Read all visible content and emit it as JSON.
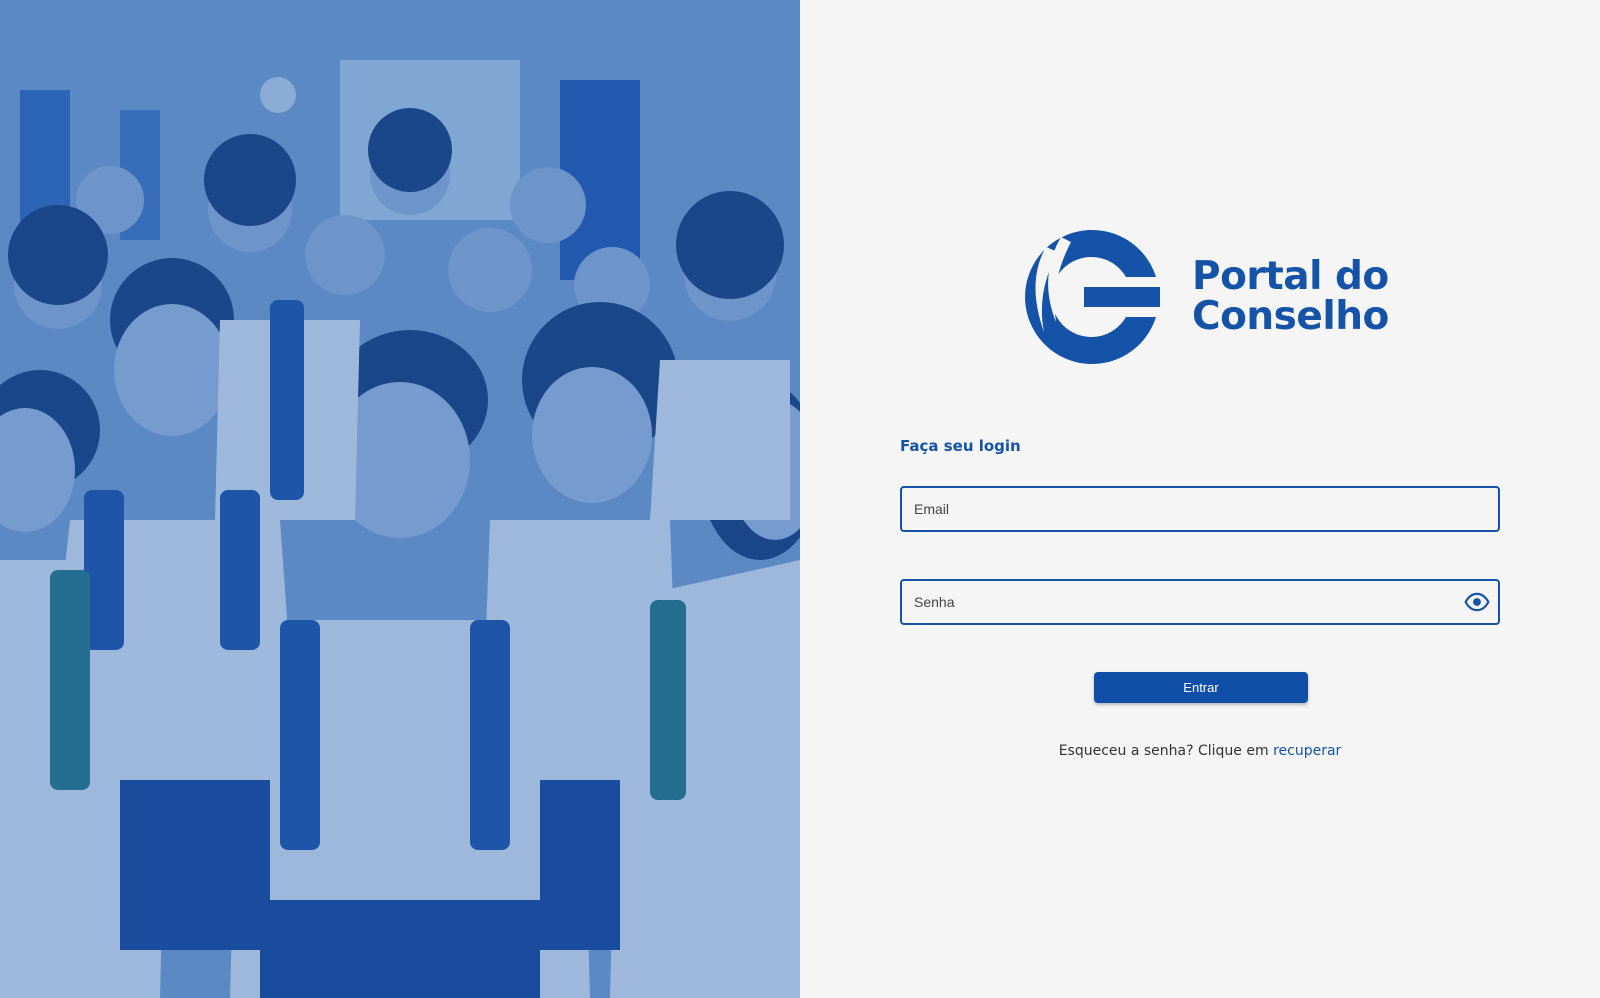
{
  "brand": {
    "name_line1": "Portal do",
    "name_line2": "Conselho",
    "color": "#1553a8"
  },
  "hero": {
    "image": "students-group-photo"
  },
  "login": {
    "title": "Faça seu login",
    "email_placeholder": "Email",
    "password_placeholder": "Senha",
    "password_toggle_icon": "eye-icon",
    "submit_label": "Entrar",
    "recover_prompt": "Esqueceu a senha? Clique em",
    "recover_link": "recuperar"
  },
  "colors": {
    "accent": "#1553a8",
    "button": "#0f4fa8",
    "panel_bg": "#f5f5f5"
  }
}
